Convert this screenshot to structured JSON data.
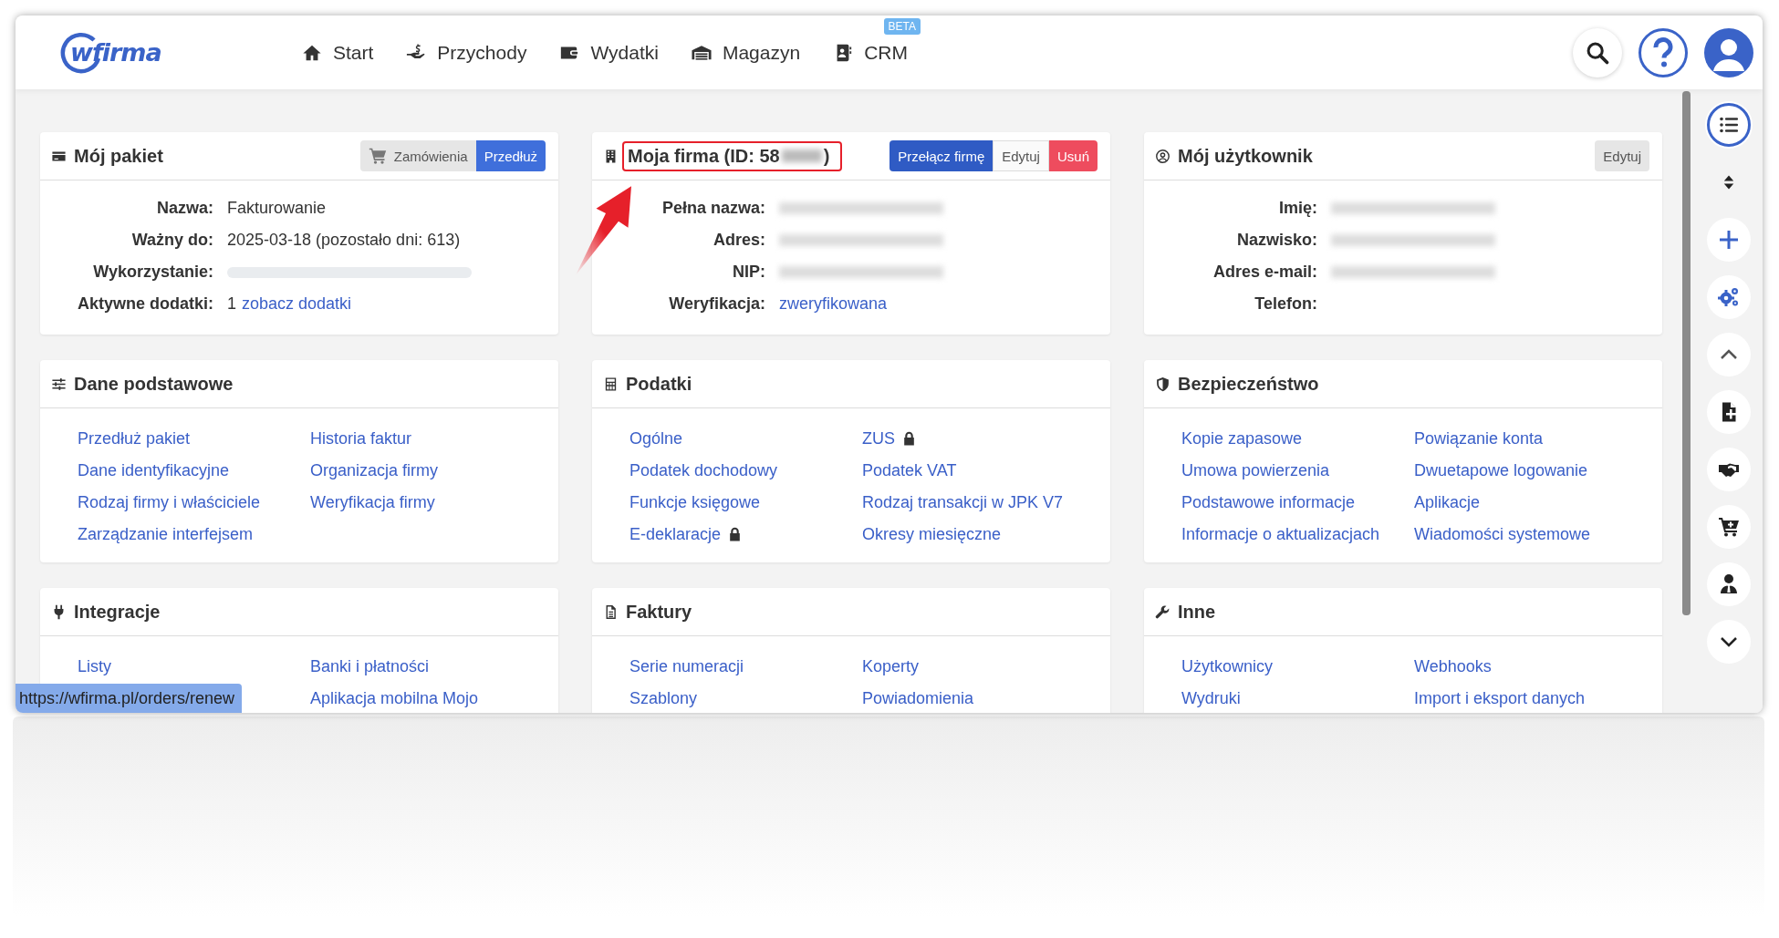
{
  "header": {
    "logo": "wfirma",
    "nav": [
      {
        "label": "Start"
      },
      {
        "label": "Przychody"
      },
      {
        "label": "Wydatki"
      },
      {
        "label": "Magazyn"
      },
      {
        "label": "CRM",
        "badge": "BETA"
      }
    ]
  },
  "cards": [
    {
      "kind": "fields",
      "title": "Mój pakiet",
      "buttons": [
        {
          "label": "Zamówienia",
          "kind": "secondary"
        },
        {
          "label": "Przedłuż",
          "kind": "primary"
        }
      ],
      "fields": [
        {
          "label": "Nazwa:",
          "value": "Fakturowanie"
        },
        {
          "label": "Ważny do:",
          "value": "2025-03-18 (pozostało dni: 613)"
        },
        {
          "label": "Wykorzystanie:",
          "kind": "meter"
        },
        {
          "label": "Aktywne dodatki:",
          "value": "1",
          "link": "zobacz dodatki"
        }
      ]
    },
    {
      "kind": "fields",
      "title": "Moja firma (ID: 58",
      "title_suffix": ")",
      "highlighted": true,
      "buttons": [
        {
          "label": "Przełącz firmę",
          "kind": "primary"
        },
        {
          "label": "Edytuj",
          "kind": "plain"
        },
        {
          "label": "Usuń",
          "kind": "danger"
        }
      ],
      "fields": [
        {
          "label": "Pełna nazwa:",
          "redacted": true
        },
        {
          "label": "Adres:",
          "redacted": true
        },
        {
          "label": "NIP:",
          "redacted": true
        },
        {
          "label": "Weryfikacja:",
          "link": "zweryfikowana"
        }
      ]
    },
    {
      "kind": "fields",
      "title": "Mój użytkownik",
      "buttons": [
        {
          "label": "Edytuj",
          "kind": "secondary"
        }
      ],
      "fields": [
        {
          "label": "Imię:",
          "redacted": true
        },
        {
          "label": "Nazwisko:",
          "redacted": true
        },
        {
          "label": "Adres e-mail:",
          "redacted": true
        },
        {
          "label": "Telefon:"
        }
      ]
    },
    {
      "kind": "links",
      "title": "Dane podstawowe",
      "columns": [
        [
          {
            "label": "Przedłuż pakiet"
          },
          {
            "label": "Dane identyfikacyjne"
          },
          {
            "label": "Rodzaj firmy i właściciele"
          },
          {
            "label": "Zarządzanie interfejsem"
          }
        ],
        [
          {
            "label": "Historia faktur"
          },
          {
            "label": "Organizacja firmy"
          },
          {
            "label": "Weryfikacja firmy"
          }
        ]
      ]
    },
    {
      "kind": "links",
      "title": "Podatki",
      "columns": [
        [
          {
            "label": "Ogólne",
            "locked": false
          },
          {
            "label": "Podatek dochodowy",
            "locked": false
          },
          {
            "label": "Funkcje księgowe",
            "locked": false
          },
          {
            "label": "E-deklaracje",
            "locked": true
          }
        ],
        [
          {
            "label": "ZUS",
            "locked": true
          },
          {
            "label": "Podatek VAT",
            "locked": false
          },
          {
            "label": "Rodzaj transakcji w JPK V7",
            "locked": false
          },
          {
            "label": "Okresy miesięczne",
            "locked": false
          }
        ]
      ]
    },
    {
      "kind": "links",
      "title": "Bezpieczeństwo",
      "columns": [
        [
          {
            "label": "Kopie zapasowe"
          },
          {
            "label": "Umowa powierzenia"
          },
          {
            "label": "Podstawowe informacje"
          },
          {
            "label": "Informacje o aktualizacjach"
          }
        ],
        [
          {
            "label": "Powiązanie konta"
          },
          {
            "label": "Dwuetapowe logowanie"
          },
          {
            "label": "Aplikacje"
          },
          {
            "label": "Wiadomości systemowe"
          }
        ]
      ]
    },
    {
      "kind": "links",
      "title": "Integracje",
      "columns": [
        [
          {
            "label": "Listy"
          }
        ],
        [
          {
            "label": "Banki i płatności"
          },
          {
            "label": "Aplikacja mobilna Mojo"
          }
        ]
      ]
    },
    {
      "kind": "links",
      "title": "Faktury",
      "columns": [
        [
          {
            "label": "Serie numeracji"
          },
          {
            "label": "Szablony"
          }
        ],
        [
          {
            "label": "Koperty"
          },
          {
            "label": "Powiadomienia"
          }
        ]
      ]
    },
    {
      "kind": "links",
      "title": "Inne",
      "columns": [
        [
          {
            "label": "Użytkownicy"
          },
          {
            "label": "Wydruki"
          }
        ],
        [
          {
            "label": "Webhooks"
          },
          {
            "label": "Import i eksport danych"
          }
        ]
      ]
    }
  ],
  "side_rail": [
    {
      "selected": true
    },
    {
      "selected": false
    },
    {
      "selected": false
    },
    {
      "selected": false
    },
    {
      "selected": false
    },
    {
      "selected": false
    },
    {
      "selected": false
    },
    {
      "selected": false
    },
    {
      "selected": false
    },
    {
      "selected": false
    }
  ],
  "status_url": "https://wfirma.pl/orders/renew"
}
